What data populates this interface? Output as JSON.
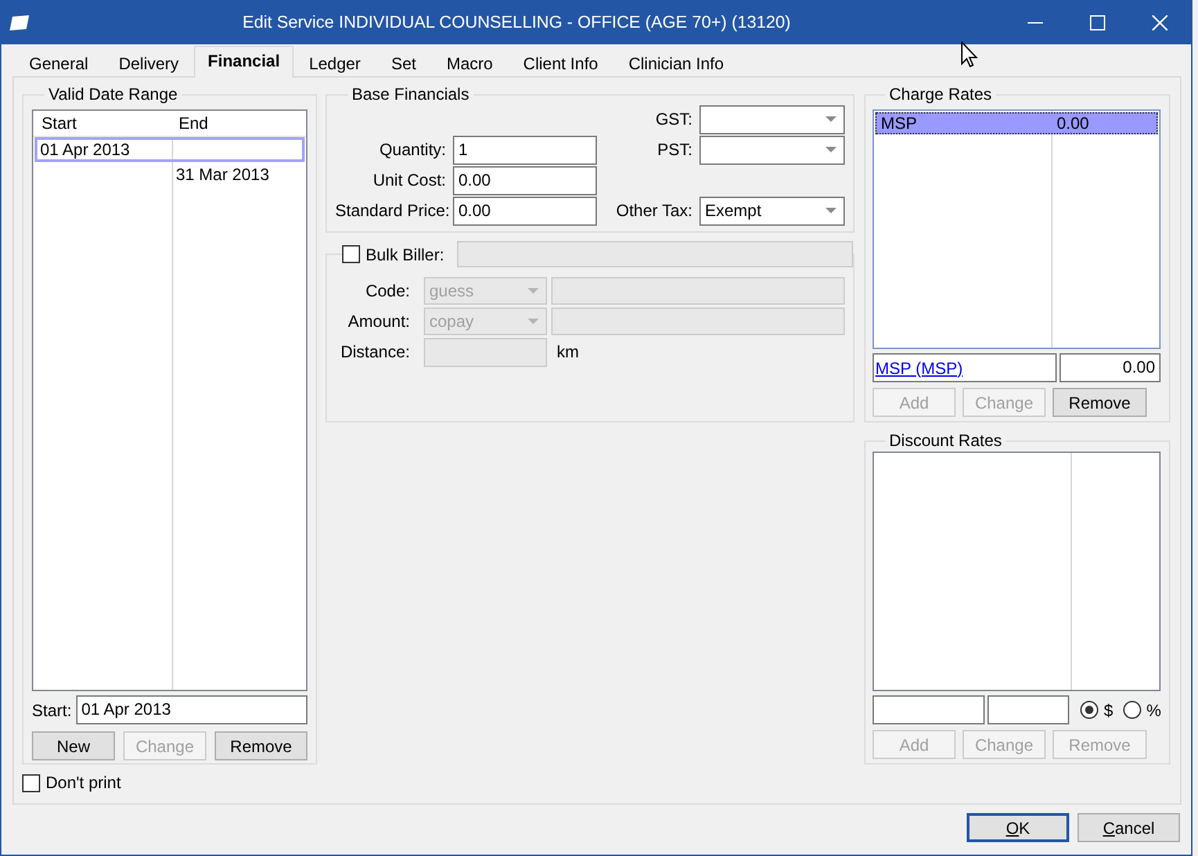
{
  "window": {
    "title": "Edit Service INDIVIDUAL COUNSELLING - OFFICE (AGE 70+) (13120)"
  },
  "tabs": [
    {
      "label": "General",
      "selected": false
    },
    {
      "label": "Delivery",
      "selected": false
    },
    {
      "label": "Financial",
      "selected": true
    },
    {
      "label": "Ledger",
      "selected": false
    },
    {
      "label": "Set",
      "selected": false
    },
    {
      "label": "Macro",
      "selected": false
    },
    {
      "label": "Client Info",
      "selected": false
    },
    {
      "label": "Clinician Info",
      "selected": false
    }
  ],
  "valid_date_range": {
    "title": "Valid Date Range",
    "columns": [
      "Start",
      "End"
    ],
    "rows": [
      {
        "start": "01 Apr 2013",
        "selected": true
      },
      {
        "end": "31 Mar 2013",
        "selected": false
      }
    ],
    "start_field": {
      "label": "Start:",
      "value": "01 Apr 2013"
    },
    "buttons": [
      {
        "label": "New",
        "disabled": false
      },
      {
        "label": "Change",
        "disabled": true
      },
      {
        "label": "Remove",
        "disabled": false
      }
    ]
  },
  "dont_print": {
    "label": "Don't print",
    "checked": false
  },
  "base_financials": {
    "title": "Base Financials",
    "left_fields": [
      {
        "label": "Quantity:",
        "value": "1"
      },
      {
        "label": "Unit Cost:",
        "value": "0.00"
      },
      {
        "label": "Standard Price:",
        "value": "0.00"
      }
    ],
    "right_fields": [
      {
        "label": "GST:"
      },
      {
        "label": "PST:"
      },
      {
        "label": "Other Tax:",
        "value": "Exempt"
      }
    ]
  },
  "bulk_biller": {
    "label": "Bulk Biller:",
    "checked": false,
    "fields": [
      {
        "label": "Code:",
        "kind": "combo",
        "value": "guess"
      },
      {
        "label": "Amount:",
        "kind": "combo",
        "value": "copay"
      },
      {
        "label": "Distance:",
        "kind": "unit",
        "unit": "km"
      }
    ]
  },
  "charge_rates": {
    "title": "Charge Rates",
    "rows": [
      {
        "name": "MSP",
        "amount": "0.00",
        "selected": true
      }
    ],
    "link": "MSP (MSP)",
    "amount": "0.00",
    "buttons": [
      {
        "label": "Add",
        "disabled": true
      },
      {
        "label": "Change",
        "disabled": true
      },
      {
        "label": "Remove",
        "disabled": false
      }
    ]
  },
  "discount_rates": {
    "title": "Discount Rates",
    "options": [
      {
        "label": "$",
        "selected": true
      },
      {
        "label": "%",
        "selected": false
      }
    ],
    "buttons": [
      {
        "label": "Add",
        "disabled": true
      },
      {
        "label": "Change",
        "disabled": true
      },
      {
        "label": "Remove",
        "disabled": true
      }
    ]
  },
  "footer_buttons": [
    {
      "label": "OK",
      "default": true,
      "access_key_shown": true
    },
    {
      "label": "Cancel",
      "default": false,
      "access_key_shown": true
    }
  ]
}
